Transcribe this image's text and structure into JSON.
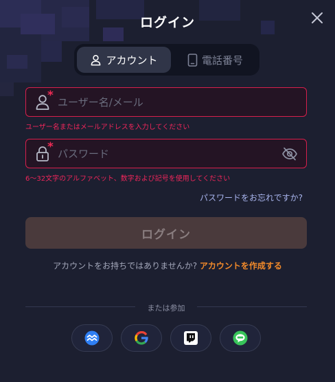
{
  "dialog": {
    "title": "ログイン",
    "tabs": [
      {
        "label": "アカウント",
        "icon": "person-icon",
        "active": true
      },
      {
        "label": "電話番号",
        "icon": "phone-icon",
        "active": false
      }
    ]
  },
  "form": {
    "username": {
      "placeholder": "ユーザー名/メール",
      "value": "",
      "required_mark": "*",
      "error": "ユーザー名またはメールアドレスを入力してください"
    },
    "password": {
      "placeholder": "パスワード",
      "value": "",
      "required_mark": "*",
      "error": "6～32文字のアルファベット、数字および記号を使用してください"
    },
    "forgot_label": "パスワードをお忘れですか?",
    "submit_label": "ログイン"
  },
  "signup": {
    "prompt": "アカウントをお持ちではありませんか?",
    "link_label": "アカウントを作成する"
  },
  "social": {
    "divider_label": "または参加",
    "providers": [
      "metamask-icon",
      "google-icon",
      "twitch-icon",
      "line-icon"
    ]
  },
  "colors": {
    "background": "#1c1f30",
    "error": "#f1265b",
    "accent_link": "#f28a2a",
    "forgot_link": "#a9b5ee"
  }
}
